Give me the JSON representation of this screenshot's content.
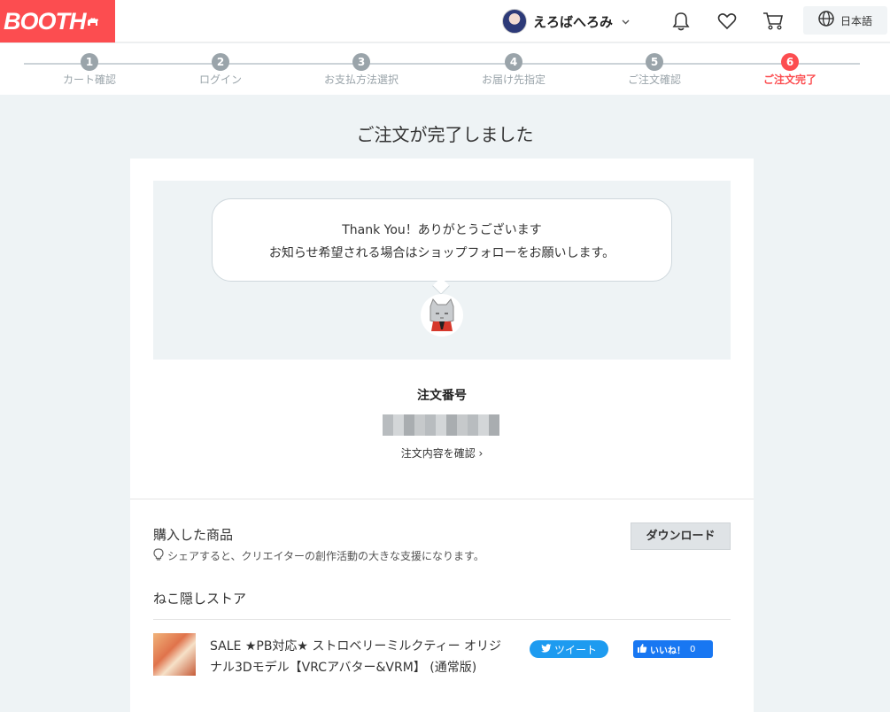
{
  "header": {
    "logo": "BOOTH",
    "user_name": "えろばへろみ",
    "language": "日本語"
  },
  "steps": [
    {
      "num": "1",
      "label": "カート確認"
    },
    {
      "num": "2",
      "label": "ログイン"
    },
    {
      "num": "3",
      "label": "お支払方法選択"
    },
    {
      "num": "4",
      "label": "お届け先指定"
    },
    {
      "num": "5",
      "label": "ご注文確認"
    },
    {
      "num": "6",
      "label": "ご注文完了",
      "active": true
    }
  ],
  "page_title": "ご注文が完了しました",
  "thanks": {
    "line1": "Thank You！ありがとうございます",
    "line2": "お知らせ希望される場合はショップフォローをお願いします。"
  },
  "order": {
    "label": "注文番号",
    "number": "",
    "details_link": "注文内容を確認 ›"
  },
  "purchased": {
    "title": "購入した商品",
    "share_tip": "シェアすると、クリエイターの創作活動の大きな支援になります。",
    "download_label": "ダウンロード",
    "shop_name": "ねこ隠しストア",
    "item_name": "SALE ★PB対応★ ストロベリーミルクティー オリジナル3Dモデル【VRCアバター&VRM】 (通常版)",
    "tweet_label": "ツイート",
    "like_label": "いいね！",
    "like_count": "0"
  },
  "colors": {
    "brand": "#fc4d50",
    "background": "#eef3f5",
    "twitter": "#1d9bf0",
    "facebook": "#1877f2"
  },
  "icons": [
    "bell-icon",
    "heart-icon",
    "cart-icon",
    "globe-icon",
    "lightbulb-icon",
    "twitter-bird-icon",
    "thumbs-up-icon"
  ]
}
